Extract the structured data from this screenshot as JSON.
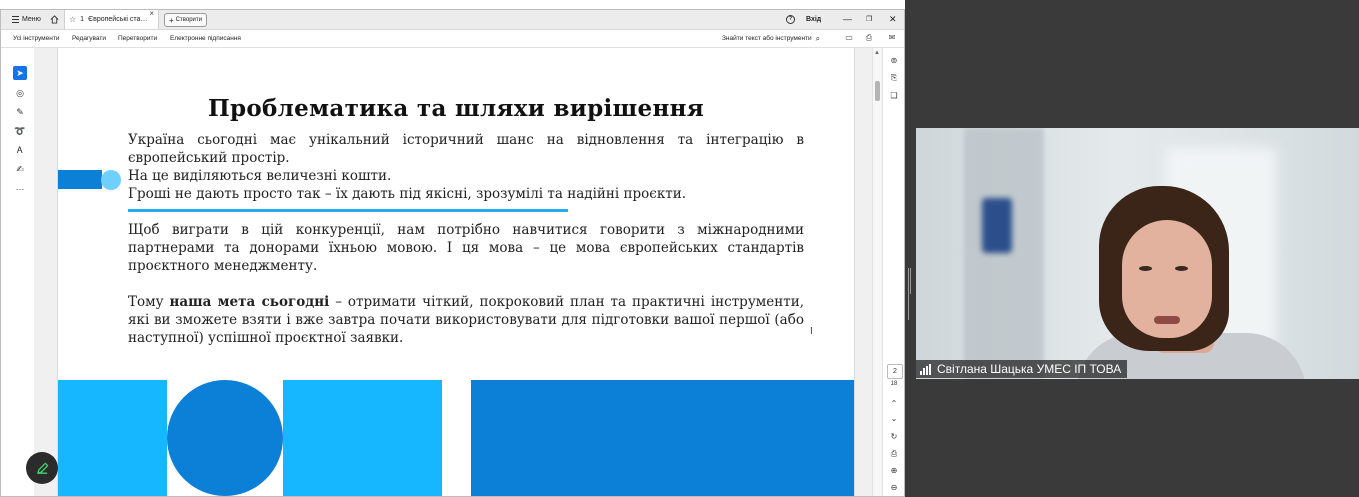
{
  "titlebar": {
    "menu_label": "Меню",
    "tab_number": "1",
    "tab_title": "Європейські ста…",
    "tab_close": "×",
    "create_label": "Створити",
    "login_label": "Вхід",
    "minimize": "—",
    "maximize": "❐",
    "close": "✕"
  },
  "toolbar": {
    "items": [
      "Усі інструменти",
      "Редагувати",
      "Перетворити",
      "Електронне підписання"
    ],
    "find_text": "Знайти текст або інструменти"
  },
  "slide": {
    "title": "Проблематика та шляхи вирішення",
    "p1_line1": "Україна сьогодні має унікальний історичний шанс на відновлення та інтеграцію в європейський простір.",
    "p1_line2": "На це виділяються величезні кошти.",
    "p1_line3": "Гроші не дають просто так – їх дають під якісні, зрозумілі та надійні проєкти.",
    "p2": "Щоб виграти в цій конкуренції, нам потрібно навчитися говорити з міжнародними партнерами та донорами їхньою мовою. І ця мова – це мова європейських стандартів проєктного менеджменту.",
    "p3_before": "Тому ",
    "p3_bold": "наша мета сьогодні",
    "p3_after": " – отримати чіткий, покроковий план та практичні інструменти, які ви зможете взяти і вже завтра почати використовувати для підготовки вашої першої (або наступної) успішної проєктної заявки."
  },
  "pager": {
    "current_page": "2",
    "total_pages": "18"
  },
  "video": {
    "participant_name": "Світлана Шацька УМЕС ІП ТОВА"
  },
  "colors": {
    "accent_blue": "#0c7fd6",
    "light_blue": "#17b7ff",
    "acrobat_blue": "#1473e6"
  }
}
